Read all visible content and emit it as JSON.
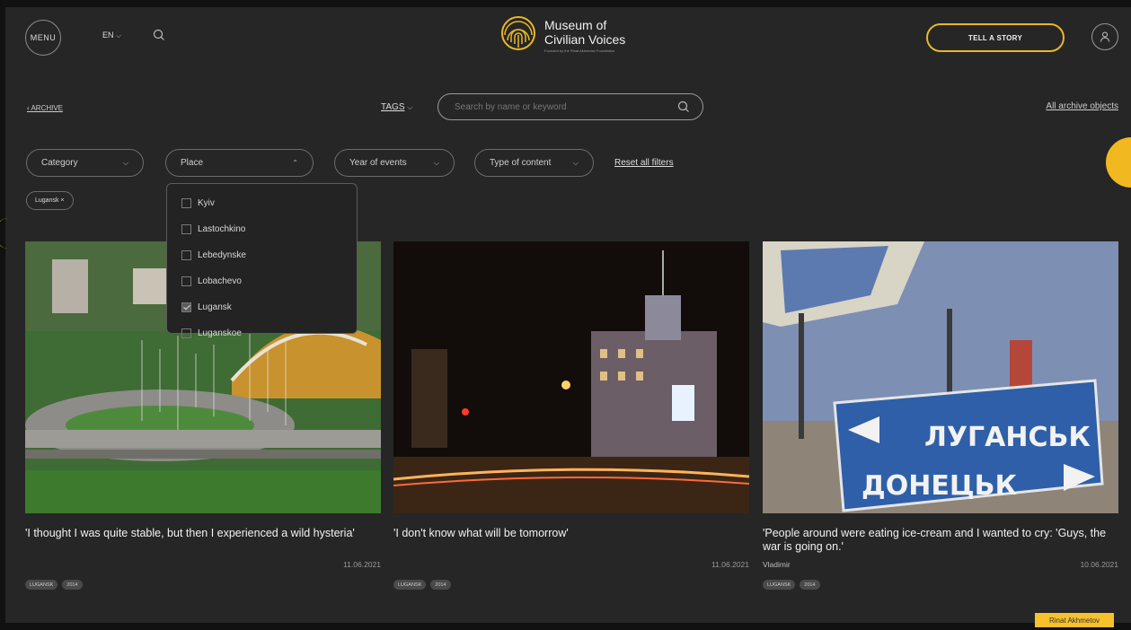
{
  "header": {
    "menu_label": "MENU",
    "language": "EN",
    "logo_line1": "Museum of",
    "logo_line2": "Civilian Voices",
    "logo_subtitle": "Founded by the Rinat Akhmetov Foundation",
    "tell_story_label": "TELL A STORY",
    "icons": [
      "search-icon",
      "user-icon",
      "chevron-down-icon"
    ],
    "accent_color": "#e8b82a"
  },
  "toolbar": {
    "archive_link": "ARCHIVE",
    "tags_label": "TAGS",
    "search_placeholder": "Search by name or keyword",
    "all_archive_label": "All archive objects"
  },
  "filters": {
    "category": "Category",
    "place": "Place",
    "year": "Year of events",
    "type": "Type of content",
    "reset": "Reset all filters",
    "active_chip": "Lugansk ×"
  },
  "place_dropdown": {
    "options": [
      {
        "label": "Kyiv",
        "checked": false
      },
      {
        "label": "Lastochkino",
        "checked": false
      },
      {
        "label": "Lebedynske",
        "checked": false
      },
      {
        "label": "Lobachevo",
        "checked": false
      },
      {
        "label": "Lugansk",
        "checked": true
      },
      {
        "label": "Luganskoe",
        "checked": false
      }
    ]
  },
  "cards": [
    {
      "title": "'I thought I was quite stable, but then I experienced a wild hysteria'",
      "author": "",
      "date": "11.06.2021",
      "tags": [
        "LUGANSK",
        "2014"
      ]
    },
    {
      "title": "'I don't know what will be tomorrow'",
      "author": "",
      "date": "11.06.2021",
      "tags": [
        "LUGANSK",
        "2014"
      ]
    },
    {
      "title": "'People around were eating ice-cream and I wanted to cry: 'Guys, the war is going on.'",
      "author": "Vladimir",
      "date": "10.06.2021",
      "tags": [
        "LUGANSK",
        "2014"
      ]
    }
  ],
  "road_sign": {
    "line1": "ЛУГАНСЬК",
    "line2": "ДОНЕЦЬК"
  },
  "footer_badge": "Rinat Akhmetov"
}
